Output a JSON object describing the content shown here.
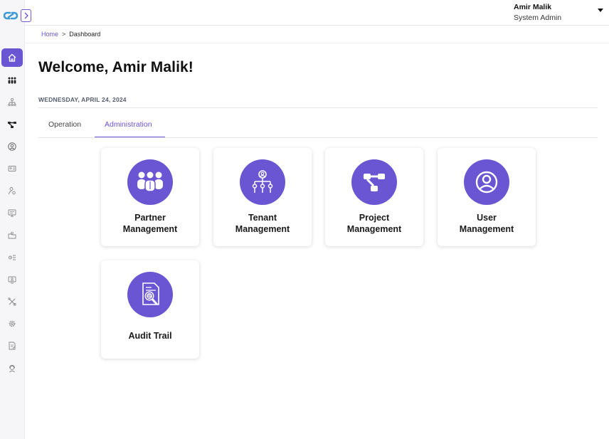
{
  "header": {
    "user_name": "Amir Malik",
    "user_role": "System Admin"
  },
  "breadcrumb": {
    "home": "Home",
    "separator": ">",
    "current": "Dashboard"
  },
  "main": {
    "welcome": "Welcome, Amir Malik!",
    "date": "WEDNESDAY, APRIL 24, 2024",
    "tabs": [
      {
        "label": "Operation",
        "active": false
      },
      {
        "label": "Administration",
        "active": true
      }
    ],
    "cards": [
      {
        "line1": "Partner",
        "line2": "Management",
        "icon": "partner-group-icon"
      },
      {
        "line1": "Tenant",
        "line2": "Management",
        "icon": "tenant-hierarchy-icon"
      },
      {
        "line1": "Project",
        "line2": "Management",
        "icon": "project-flow-icon"
      },
      {
        "line1": "User",
        "line2": "Management",
        "icon": "user-icon"
      },
      {
        "line1": "Audit Trail",
        "line2": "",
        "icon": "audit-document-search-icon"
      }
    ]
  },
  "sidebar": {
    "items": [
      {
        "icon": "home-icon",
        "active": true
      },
      {
        "icon": "people-group-icon"
      },
      {
        "icon": "org-chart-icon"
      },
      {
        "icon": "project-flow-icon"
      },
      {
        "icon": "user-circle-icon"
      },
      {
        "icon": "id-card-icon"
      },
      {
        "icon": "user-settings-icon"
      },
      {
        "icon": "monitor-icon"
      },
      {
        "icon": "folder-user-icon"
      },
      {
        "icon": "gears-icon"
      },
      {
        "icon": "display-user-icon"
      },
      {
        "icon": "tools-icon"
      },
      {
        "icon": "gear-icon"
      },
      {
        "icon": "document-edit-icon"
      },
      {
        "icon": "support-agent-icon"
      }
    ]
  },
  "colors": {
    "accent": "#6a55d3",
    "logo": "#3c9ad6"
  }
}
